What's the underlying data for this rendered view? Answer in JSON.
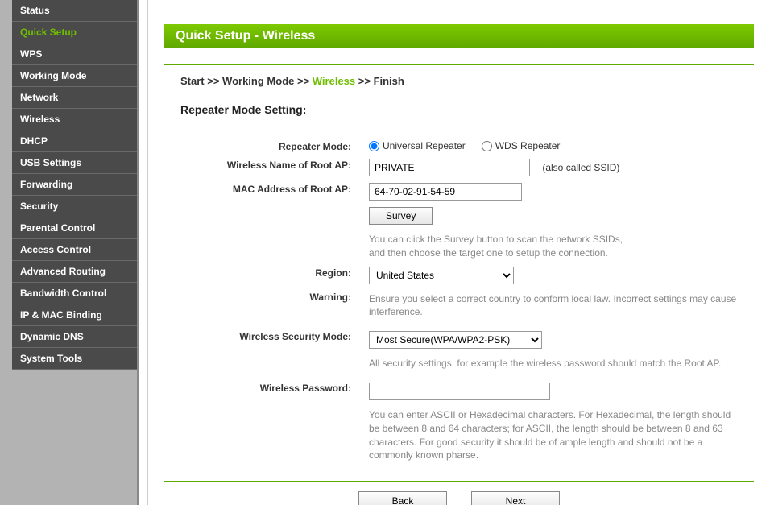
{
  "sidebar": {
    "items": [
      {
        "label": "Status"
      },
      {
        "label": "Quick Setup"
      },
      {
        "label": "WPS"
      },
      {
        "label": "Working Mode"
      },
      {
        "label": "Network"
      },
      {
        "label": "Wireless"
      },
      {
        "label": "DHCP"
      },
      {
        "label": "USB Settings"
      },
      {
        "label": "Forwarding"
      },
      {
        "label": "Security"
      },
      {
        "label": "Parental Control"
      },
      {
        "label": "Access Control"
      },
      {
        "label": "Advanced Routing"
      },
      {
        "label": "Bandwidth Control"
      },
      {
        "label": "IP & MAC Binding"
      },
      {
        "label": "Dynamic DNS"
      },
      {
        "label": "System Tools"
      }
    ],
    "active_index": 1
  },
  "header": {
    "title": "Quick Setup - Wireless"
  },
  "breadcrumb": {
    "step1": "Start",
    "sep": " >> ",
    "step2": "Working Mode",
    "step3": "Wireless",
    "step4": "Finish"
  },
  "section": {
    "title": "Repeater Mode Setting:"
  },
  "form": {
    "repeater_mode_label": "Repeater Mode:",
    "repeater_mode_options": {
      "universal": "Universal Repeater",
      "wds": "WDS Repeater"
    },
    "repeater_mode_selected": "universal",
    "ssid_label": "Wireless Name of Root AP:",
    "ssid_value": "PRIVATE",
    "ssid_note": "(also called SSID)",
    "mac_label": "MAC Address of Root AP:",
    "mac_value": "64-70-02-91-54-59",
    "survey_button": "Survey",
    "survey_help": "You can click the Survey button to scan the network SSIDs,\nand then choose the target one to setup the connection.",
    "region_label": "Region:",
    "region_value": "United States",
    "warning_label": "Warning:",
    "warning_text": "Ensure you select a correct country to conform local law. Incorrect settings may cause interference.",
    "security_mode_label": "Wireless Security Mode:",
    "security_mode_value": "Most Secure(WPA/WPA2-PSK)",
    "security_help": "All security settings, for example the wireless password should match the Root AP.",
    "password_label": "Wireless Password:",
    "password_value": "",
    "password_help": "You can enter ASCII or Hexadecimal characters. For Hexadecimal, the length should be between 8 and 64 characters; for ASCII, the length should be between 8 and 63 characters. For good security it should be of ample length and should not be a commonly known pharse."
  },
  "buttons": {
    "back": "Back",
    "next": "Next"
  }
}
